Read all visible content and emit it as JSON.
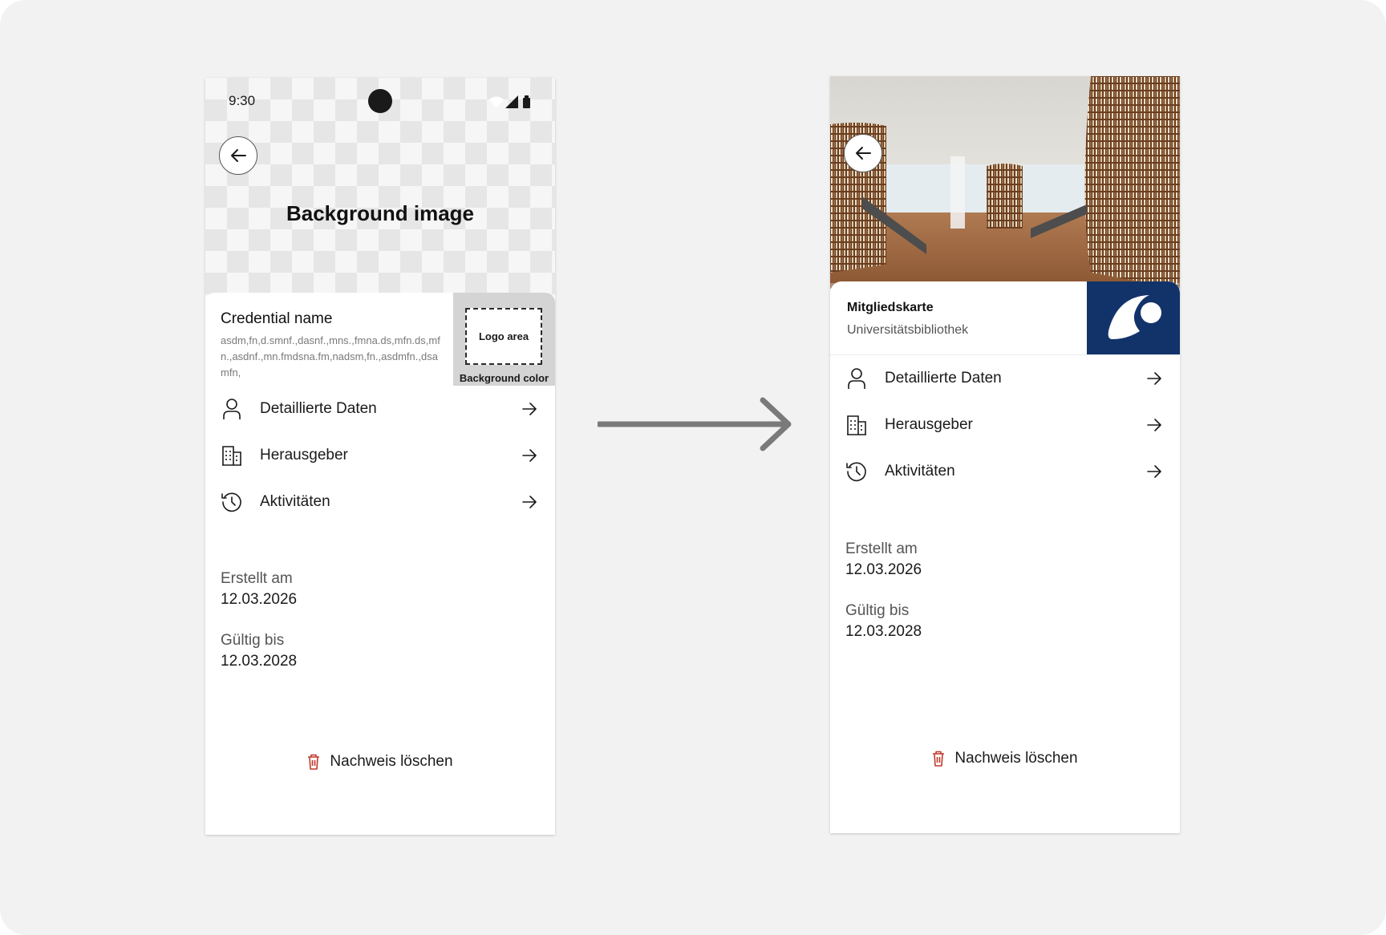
{
  "left_phone": {
    "status_time": "9:30",
    "header_title": "Background image",
    "credential_name": "Credential name",
    "credential_description": "asdm,fn,d.smnf.,dasnf.,mns.,fmna.ds,mfn.ds,mfn.,asdnf.,mn.fmdsna.fm,nadsm,fn.,asdmfn.,dsamfn,",
    "logo_area_label": "Logo area",
    "background_color_label": "Background color",
    "menu": [
      {
        "label": "Detaillierte Daten",
        "icon": "person-icon"
      },
      {
        "label": "Herausgeber",
        "icon": "building-icon"
      },
      {
        "label": "Aktivitäten",
        "icon": "history-icon"
      }
    ],
    "created_label": "Erstellt am",
    "created_value": "12.03.2026",
    "valid_label": "Gültig bis",
    "valid_value": "12.03.2028",
    "delete_label": "Nachweis löschen"
  },
  "right_phone": {
    "card_title": "Mitgliedskarte",
    "card_subtitle": "Universitätsbibliothek",
    "menu": [
      {
        "label": "Detaillierte Daten",
        "icon": "person-icon"
      },
      {
        "label": "Herausgeber",
        "icon": "building-icon"
      },
      {
        "label": "Aktivitäten",
        "icon": "history-icon"
      }
    ],
    "created_label": "Erstellt am",
    "created_value": "12.03.2026",
    "valid_label": "Gültig bis",
    "valid_value": "12.03.2028",
    "delete_label": "Nachweis löschen"
  },
  "colors": {
    "canvas": "#f2f2f2",
    "logo_background": "#12336a",
    "delete_icon": "#c0392b",
    "flow_arrow": "#7a7a7a"
  }
}
